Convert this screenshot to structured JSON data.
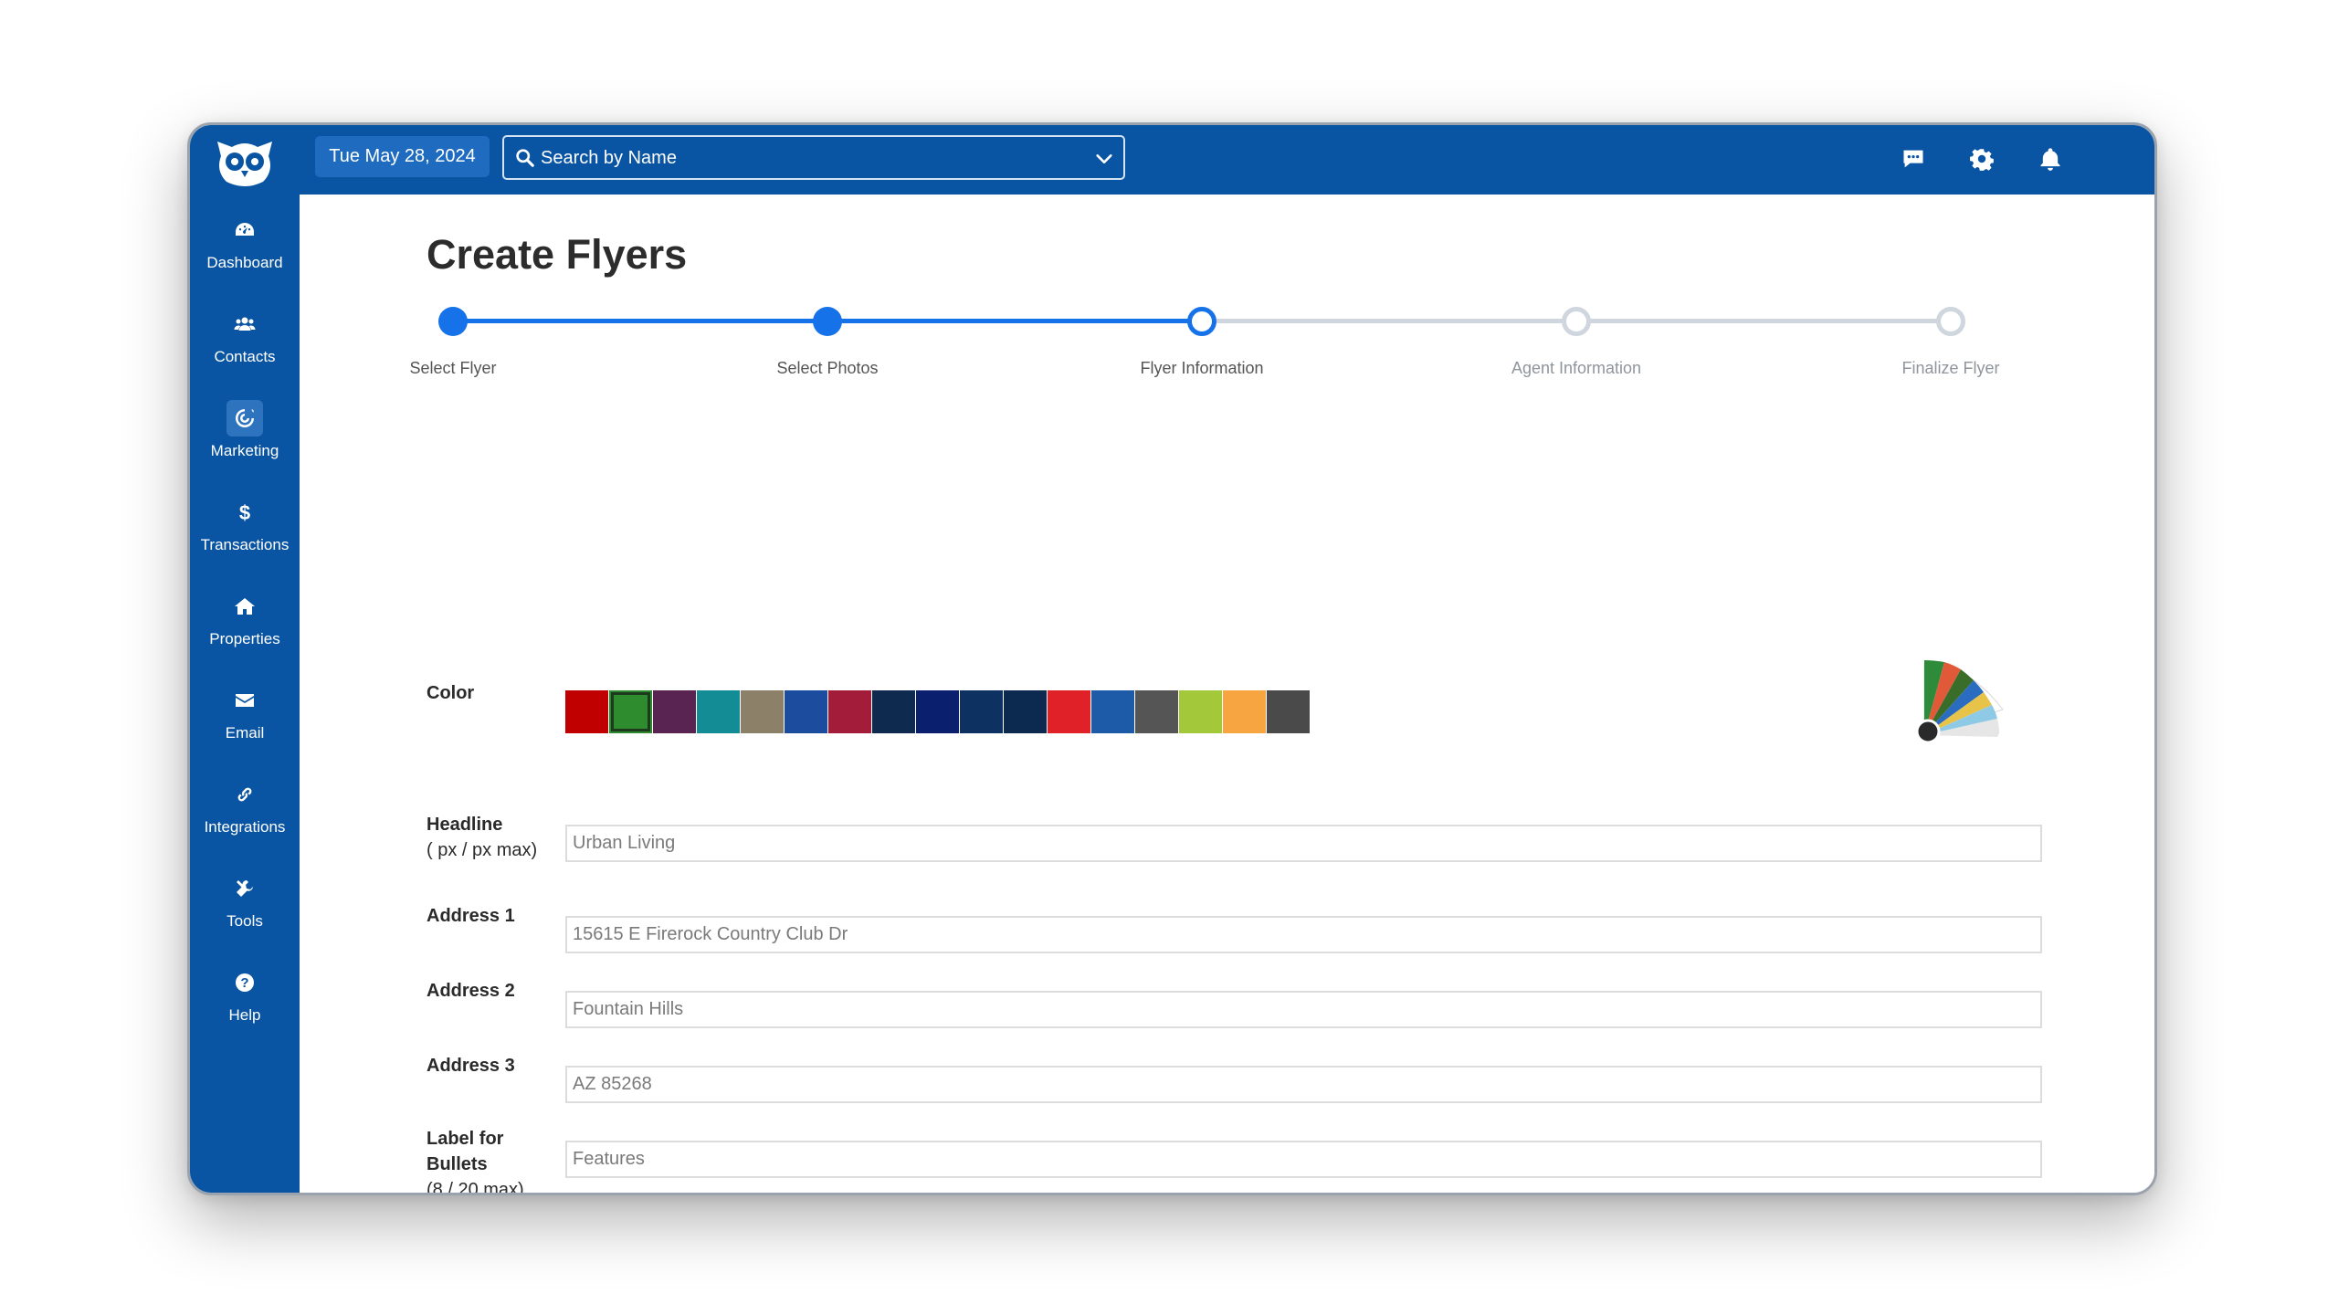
{
  "topbar": {
    "date": "Tue May 28, 2024",
    "search_placeholder": "Search by Name",
    "icons": [
      "chat-icon",
      "gear-icon",
      "bell-icon",
      "avatar"
    ]
  },
  "sidebar": {
    "items": [
      {
        "label": "Dashboard",
        "icon": "dashboard-icon"
      },
      {
        "label": "Contacts",
        "icon": "users-icon"
      },
      {
        "label": "Marketing",
        "icon": "target-icon",
        "active": true
      },
      {
        "label": "Transactions",
        "icon": "dollar-icon"
      },
      {
        "label": "Properties",
        "icon": "home-icon"
      },
      {
        "label": "Email",
        "icon": "envelope-icon"
      },
      {
        "label": "Integrations",
        "icon": "link-icon"
      },
      {
        "label": "Tools",
        "icon": "tools-icon"
      },
      {
        "label": "Help",
        "icon": "question-icon"
      }
    ]
  },
  "main": {
    "title": "Create Flyers",
    "steps": [
      {
        "label": "Select Flyer",
        "state": "done"
      },
      {
        "label": "Select Photos",
        "state": "done"
      },
      {
        "label": "Flyer Information",
        "state": "current"
      },
      {
        "label": "Agent Information",
        "state": "todo"
      },
      {
        "label": "Finalize Flyer",
        "state": "todo"
      }
    ],
    "color": {
      "label": "Color",
      "selected_index": 1,
      "swatches": [
        "#c00000",
        "#2e8b2e",
        "#5a2452",
        "#138c96",
        "#8c8168",
        "#1b4c9e",
        "#a31c3a",
        "#0e2a4e",
        "#0a1f6e",
        "#0d3160",
        "#0c2a50",
        "#e02128",
        "#1d5aa8",
        "#555555",
        "#a3c93a",
        "#f7a540",
        "#4a4a4a"
      ]
    },
    "fields": {
      "headline": {
        "label": "Headline",
        "sub": "( px / px max)",
        "value": "Urban Living"
      },
      "address1": {
        "label": "Address 1",
        "value": "15615 E Firerock Country Club Dr"
      },
      "address2": {
        "label": "Address 2",
        "value": "Fountain Hills"
      },
      "address3": {
        "label": "Address 3",
        "value": "AZ 85268"
      },
      "bullets_label": {
        "label": "Label for Bullets",
        "sub": "(8 / 20 max)",
        "value": "Features"
      }
    }
  }
}
